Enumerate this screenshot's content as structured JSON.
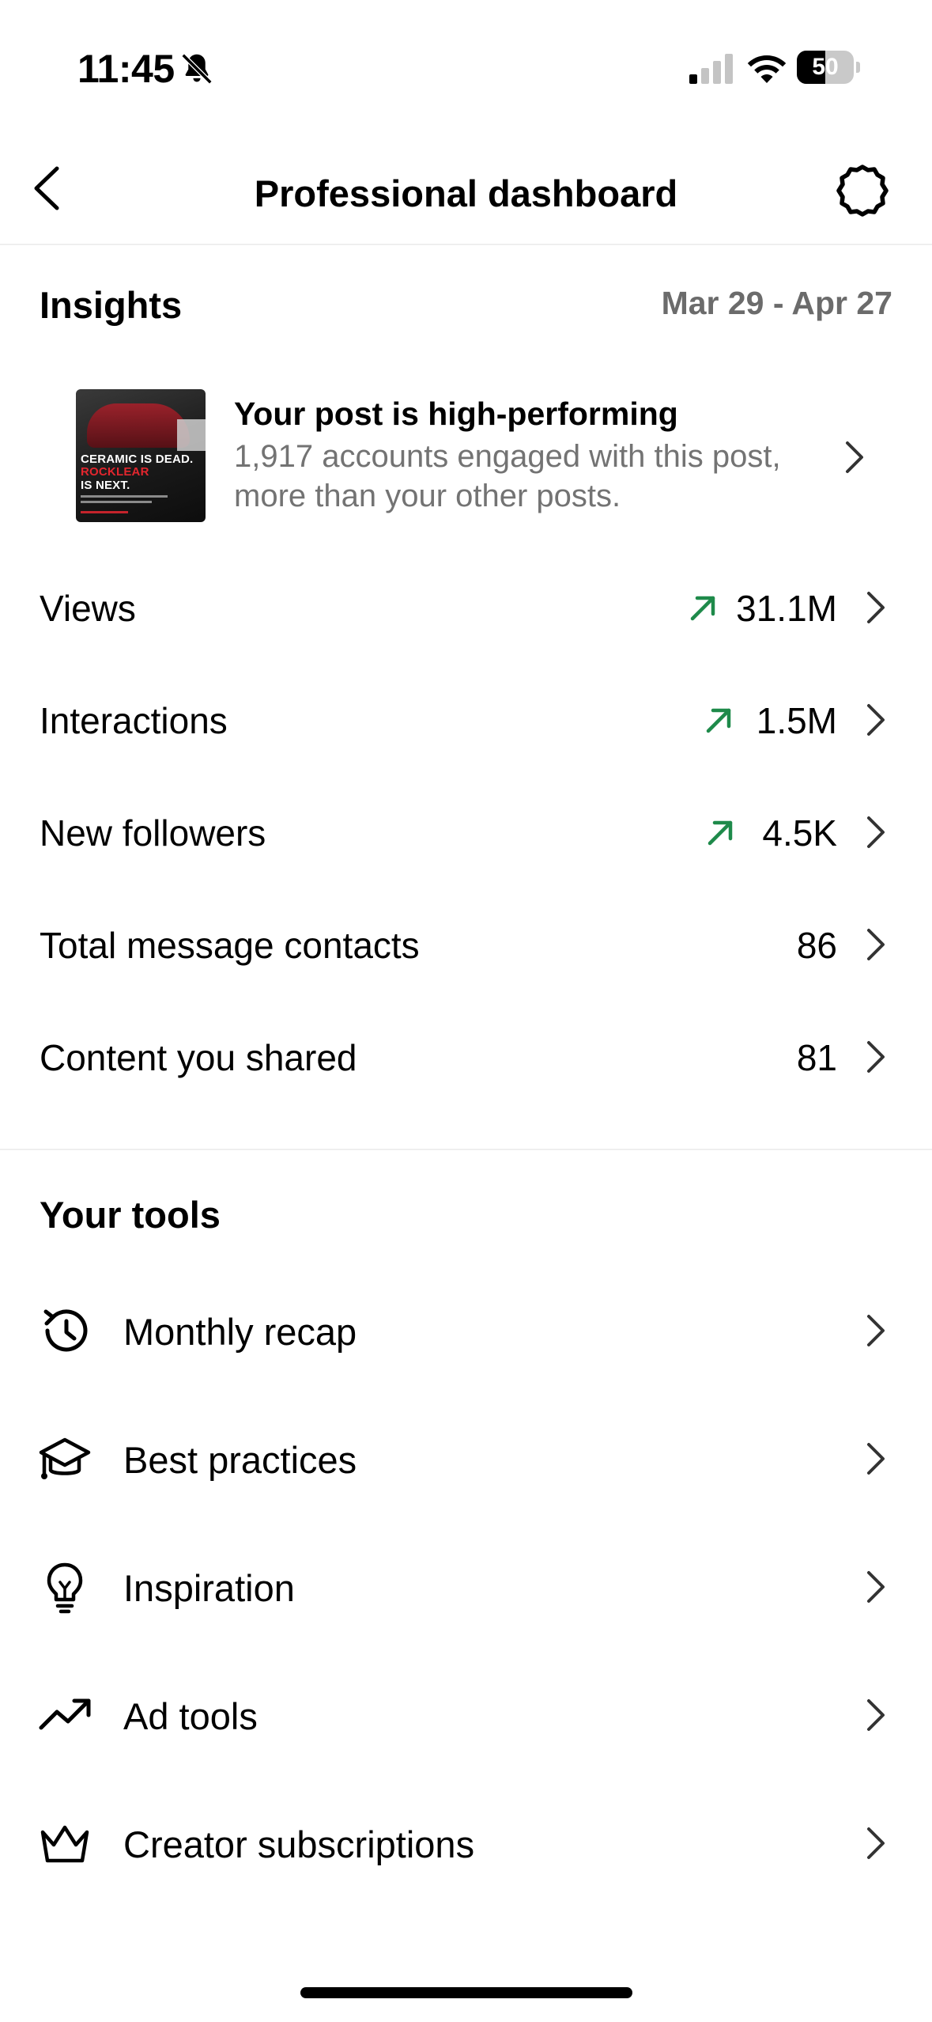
{
  "status_bar": {
    "time": "11:45",
    "battery_level": "50",
    "battery_fraction": 0.5
  },
  "nav": {
    "title": "Professional dashboard"
  },
  "insights": {
    "title": "Insights",
    "date_range": "Mar 29 - Apr 27",
    "post_card": {
      "title": "Your post is high-performing",
      "description": "1,917 accounts engaged with this post, more than your other posts.",
      "thumb_line1": "CERAMIC IS DEAD.",
      "thumb_line2": "ROCKLEAR",
      "thumb_line3": "IS NEXT."
    },
    "metrics": [
      {
        "label": "Views",
        "value": "31.1M",
        "trend": "up"
      },
      {
        "label": "Interactions",
        "value": "1.5M",
        "trend": "up"
      },
      {
        "label": "New followers",
        "value": "4.5K",
        "trend": "up"
      },
      {
        "label": "Total message contacts",
        "value": "86",
        "trend": "none"
      },
      {
        "label": "Content you shared",
        "value": "81",
        "trend": "none"
      }
    ]
  },
  "tools": {
    "title": "Your tools",
    "items": [
      {
        "label": "Monthly recap",
        "icon": "history-icon"
      },
      {
        "label": "Best practices",
        "icon": "graduation-cap-icon"
      },
      {
        "label": "Inspiration",
        "icon": "lightbulb-icon"
      },
      {
        "label": "Ad tools",
        "icon": "trending-up-icon"
      },
      {
        "label": "Creator subscriptions",
        "icon": "crown-icon"
      }
    ]
  },
  "colors": {
    "trend_up": "#1e8a4a",
    "secondary_text": "#737373",
    "divider": "#efefef"
  }
}
